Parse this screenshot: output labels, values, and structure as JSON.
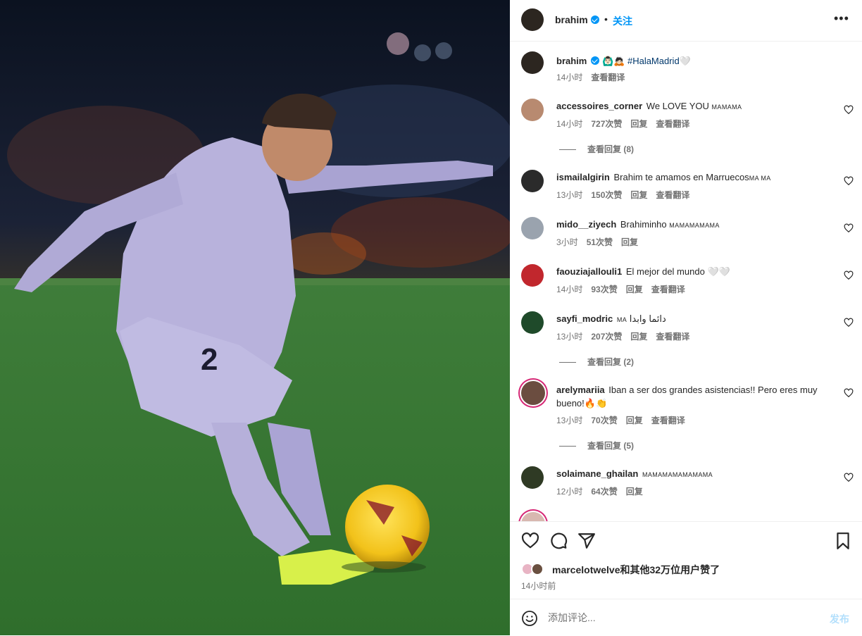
{
  "colors": {
    "accent": "#0095f6",
    "muted": "#737373",
    "text": "#262626",
    "post_disabled": "#b2dffc"
  },
  "post": {
    "image_icon": "football-player-photo",
    "author": "brahim",
    "follow_label": "关注",
    "more_icon": "more-horizontal-icon"
  },
  "caption": {
    "username": "brahim",
    "emojis": "🙆🏻‍♂️🙇🏻",
    "hashtag": "#HalaMadrid",
    "trailing": "🤍",
    "time": "14小时",
    "translate": "查看翻译"
  },
  "comments": [
    {
      "username": "accessoires_corner",
      "text": "We LOVE YOU",
      "deco": "MAMAMA",
      "time": "14小时",
      "likes": "727次赞",
      "reply": "回复",
      "translate": "查看翻译",
      "replies": "查看回复 (8)",
      "avatar_color": "#b88a70"
    },
    {
      "username": "ismailalgirin",
      "text": "Brahim te amamos en Marruecos",
      "deco": "MA MA",
      "time": "13小时",
      "likes": "150次赞",
      "reply": "回复",
      "translate": "查看翻译",
      "avatar_color": "#2b2b2b"
    },
    {
      "username": "mido__ziyech",
      "text": "Brahiminho",
      "deco": "MAMAMAMAMA",
      "time": "3小时",
      "likes": "51次赞",
      "reply": "回复",
      "avatar_color": "#9aa3ae"
    },
    {
      "username": "faouziajallouli1",
      "text": "El mejor del mundo",
      "deco": "🤍🤍",
      "time": "14小时",
      "likes": "93次赞",
      "reply": "回复",
      "translate": "查看翻译",
      "avatar_color": "#c1272d"
    },
    {
      "username": "sayfi_modric",
      "text": "دائما وابدا",
      "deco": "MA",
      "time": "13小时",
      "likes": "207次赞",
      "reply": "回复",
      "translate": "查看翻译",
      "replies": "查看回复 (2)",
      "avatar_color": "#1f4a2a"
    },
    {
      "username": "arelymariia",
      "text": "Iban a ser dos grandes asistencias!! Pero eres muy bueno!🔥👏",
      "time": "13小时",
      "likes": "70次赞",
      "reply": "回复",
      "translate": "查看翻译",
      "replies": "查看回复 (5)",
      "avatar_color": "#6b4d40"
    },
    {
      "username": "solaimane_ghailan",
      "text": "",
      "deco": "MAMAMAMAMAMAMA",
      "time": "12小时",
      "likes": "64次赞",
      "reply": "回复",
      "avatar_color": "#2f3a24"
    }
  ],
  "actions": {
    "like_icon": "heart-icon",
    "comment_icon": "comment-icon",
    "share_icon": "share-icon",
    "save_icon": "bookmark-icon",
    "likes_text": "marcelotwelve和其他32万位用户赞了",
    "time": "14小时前"
  },
  "composer": {
    "placeholder": "添加评论...",
    "post_label": "发布",
    "emoji_icon": "emoji-icon"
  }
}
